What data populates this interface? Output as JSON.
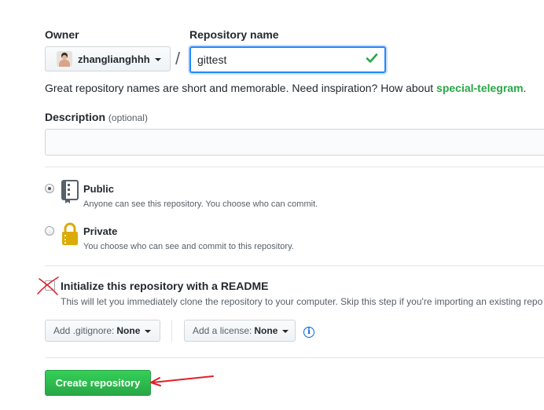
{
  "owner": {
    "label": "Owner",
    "username": "zhanglianghhh"
  },
  "repository": {
    "label": "Repository name",
    "separator": "/",
    "value": "gittest",
    "hint_text": "Great repository names are short and memorable. Need inspiration? How about ",
    "suggestion": "special-telegram",
    "hint_end": "."
  },
  "description": {
    "label": "Description",
    "optional": "(optional)",
    "value": ""
  },
  "visibility": {
    "selected": "public",
    "public": {
      "title": "Public",
      "note": "Anyone can see this repository. You choose who can commit."
    },
    "private": {
      "title": "Private",
      "note": "You choose who can see and commit to this repository."
    }
  },
  "readme": {
    "checked": false,
    "title": "Initialize this repository with a README",
    "note": "This will let you immediately clone the repository to your computer. Skip this step if you're importing an existing repo"
  },
  "gitignore": {
    "label": "Add .gitignore:",
    "value": "None"
  },
  "license": {
    "label": "Add a license:",
    "value": "None"
  },
  "info_icon": "i",
  "create_button": "Create repository",
  "colors": {
    "accent_blue": "#0366d6",
    "success_green": "#28a745",
    "annotation_red": "#e0202a"
  }
}
